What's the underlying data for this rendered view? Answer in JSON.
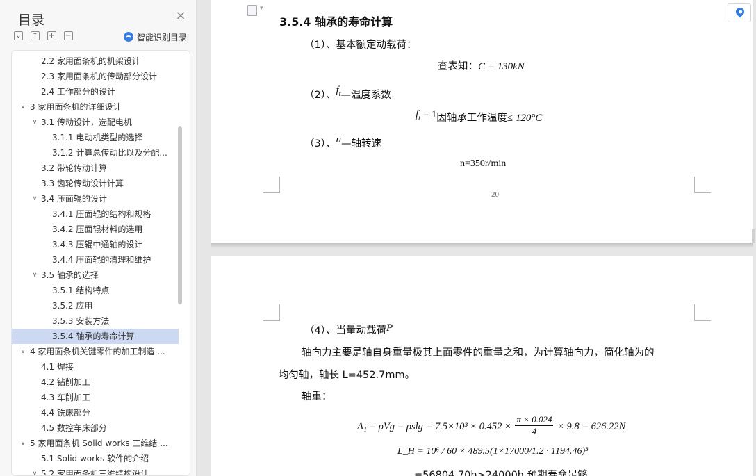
{
  "sidebar": {
    "title": "目录",
    "close_icon": "×",
    "tools": [
      "collapse-all",
      "expand-up",
      "add",
      "remove"
    ],
    "smart_toc_label": "智能识别目录",
    "items": [
      {
        "level": 2,
        "arrow": "",
        "label": "2.2 家用面条机的机架设计"
      },
      {
        "level": 2,
        "arrow": "",
        "label": "2.3 家用面条机的传动部分设计"
      },
      {
        "level": 2,
        "arrow": "",
        "label": "2.4 工作部分的设计"
      },
      {
        "level": 1,
        "arrow": "∨",
        "label": "3 家用面条机的详细设计"
      },
      {
        "level": 2,
        "arrow": "∨",
        "label": "3.1 传动设计，选配电机"
      },
      {
        "level": 3,
        "arrow": "",
        "label": "3.1.1 电动机类型的选择"
      },
      {
        "level": 3,
        "arrow": "",
        "label": "3.1.2 计算总传动比以及分配..."
      },
      {
        "level": 2,
        "arrow": "",
        "label": "3.2 带轮传动计算"
      },
      {
        "level": 2,
        "arrow": "",
        "label": "3.3 齿轮传动设计计算"
      },
      {
        "level": 2,
        "arrow": "∨",
        "label": "3.4 压面辊的设计"
      },
      {
        "level": 3,
        "arrow": "",
        "label": "3.4.1 压面辊的结构和规格"
      },
      {
        "level": 3,
        "arrow": "",
        "label": "3.4.2 压面辊材料的选用"
      },
      {
        "level": 3,
        "arrow": "",
        "label": "3.4.3 压辊中通轴的设计"
      },
      {
        "level": 3,
        "arrow": "",
        "label": "3.4.4 压面辊的清理和维护"
      },
      {
        "level": 2,
        "arrow": "∨",
        "label": "3.5 轴承的选择"
      },
      {
        "level": 3,
        "arrow": "",
        "label": "3.5.1 结构特点"
      },
      {
        "level": 3,
        "arrow": "",
        "label": "3.5.2 应用"
      },
      {
        "level": 3,
        "arrow": "",
        "label": "3.5.3 安装方法"
      },
      {
        "level": 3,
        "arrow": "",
        "label": "3.5.4 轴承的寿命计算",
        "selected": true
      },
      {
        "level": 1,
        "arrow": "∨",
        "label": "4 家用面条机关键零件的加工制造 ..."
      },
      {
        "level": 2,
        "arrow": "",
        "label": "4.1 焊接"
      },
      {
        "level": 2,
        "arrow": "",
        "label": "4.2 钻削加工"
      },
      {
        "level": 2,
        "arrow": "",
        "label": "4.3 车削加工"
      },
      {
        "level": 2,
        "arrow": "",
        "label": "4.4 铣床部分"
      },
      {
        "level": 2,
        "arrow": "",
        "label": "4.5 数控车床部分"
      },
      {
        "level": 1,
        "arrow": "∨",
        "label": "5 家用面条机 Solid works 三维结 ..."
      },
      {
        "level": 2,
        "arrow": "",
        "label": "5.1 Solid works 软件的介绍"
      },
      {
        "level": 2,
        "arrow": "∨",
        "label": "5.2 家用面条机三维结构设计"
      }
    ]
  },
  "document": {
    "heading": "3.5.4  轴承的寿命计算",
    "p1": "（1）、基本额定动载荷：",
    "p1_formula_prefix": "查表知：",
    "p1_formula": "C = 130kN",
    "p2_prefix": "（2）、",
    "p2_symbol": "f",
    "p2_sub": "t",
    "p2_suffix": "—温度系数",
    "p2_formula_lhs": "f",
    "p2_formula_sub": "t",
    "p2_formula_eq": " = 1",
    "p2_formula_text": "因轴承工作温度",
    "p2_formula_cond": "≤ 120°C",
    "p3_prefix": "（3）、",
    "p3_symbol": "n",
    "p3_suffix": "—轴转速",
    "p3_formula": "n=350r/min",
    "page_number": "20",
    "p4_prefix": "（4）、当量动载荷",
    "p4_symbol": "P",
    "p5_line1": "轴向力主要是轴自身重量极其上面零件的重量之和，为计算轴向力，简化轴为的",
    "p5_line2": "均匀轴，轴长 L=452.7mm。",
    "p6": "轴重：",
    "eq1_lhs": "A₁ = ρVg = ρslg = 7.5×10³ × 0.452 ×",
    "eq1_num": "π × 0.024",
    "eq1_den": "4",
    "eq1_rhs": "× 9.8 = 626.22N",
    "eq2": "L_H = 10⁶ / 60 × 489.5(1×17000/1.2 · 1194.46)³",
    "eq3": "=56804.70h>24000h 预期寿命足够."
  }
}
